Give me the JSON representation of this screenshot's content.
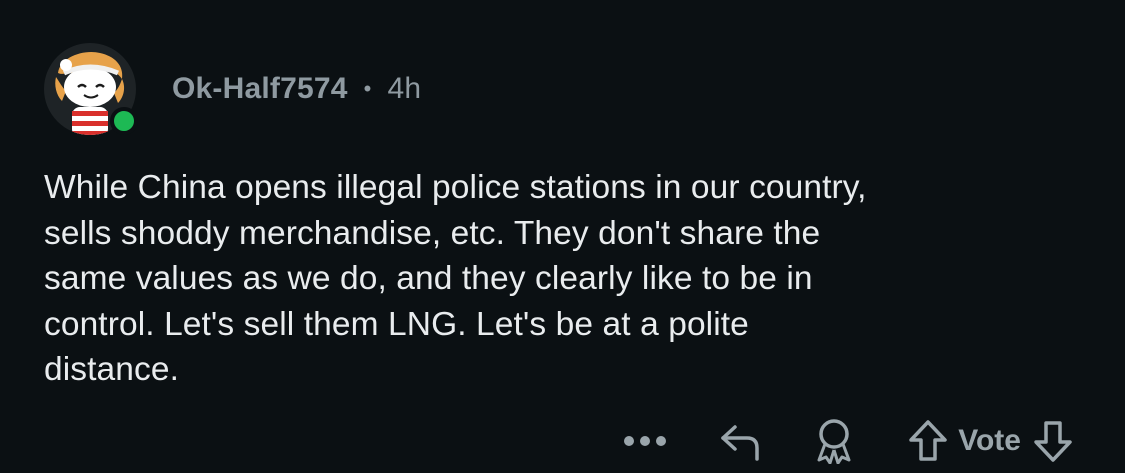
{
  "comment": {
    "username": "Ok-Half7574",
    "separator": "•",
    "timestamp": "4h",
    "avatar_icon": "snoo-avatar-icon",
    "online_status_color": "#1db954",
    "body_lines": [
      "While China opens illegal police stations in our country,",
      "sells shoddy merchandise, etc.  They don't share the",
      "same values as we do, and they clearly like to be in",
      "control.  Let's sell them LNG.  Let's be at a polite",
      "distance."
    ]
  },
  "actions": {
    "more_icon": "more-horizontal-icon",
    "reply_icon": "reply-arrow-icon",
    "award_icon": "award-ribbon-icon",
    "upvote_icon": "arrow-up-icon",
    "vote_label": "Vote",
    "downvote_icon": "arrow-down-icon"
  },
  "colors": {
    "background": "#0b1013",
    "text": "#e9ecee",
    "muted": "#8f9aa1"
  }
}
